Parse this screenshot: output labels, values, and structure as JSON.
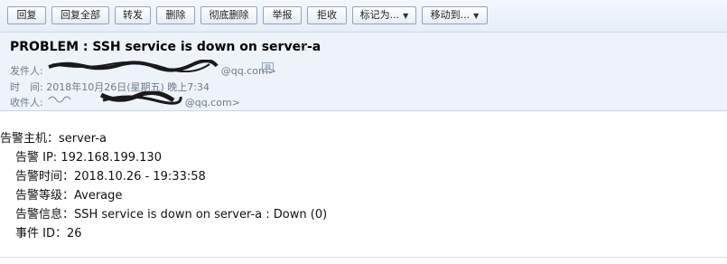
{
  "toolbar": {
    "reply": "回复",
    "reply_all": "回复全部",
    "forward": "转发",
    "delete": "删除",
    "delete_permanently": "彻底删除",
    "report": "举报",
    "reject": "拒收",
    "mark_as": "标记为...",
    "move_to": "移动到..."
  },
  "email": {
    "subject": "PROBLEM : SSH service is down on server-a",
    "from_label": "发件人:",
    "from_value": "@qq.com>",
    "time_label": "时　间:",
    "time_value": "2018年10月26日(星期五) 晚上7:34",
    "to_label": "收件人:",
    "to_value": "@qq.com>"
  },
  "body": {
    "line1": "告警主机：server-a",
    "line2": "告警 IP: 192.168.199.130",
    "line3": "告警时间：2018.10.26 - 19:33:58",
    "line4": "告警等级：Average",
    "line5": "告警信息：SSH service is down on server-a : Down (0)",
    "line6": "事件 ID：26"
  },
  "icons": {
    "star": "star-icon",
    "dropdown": "chevron-down-icon",
    "address_book": "address-card-icon"
  }
}
